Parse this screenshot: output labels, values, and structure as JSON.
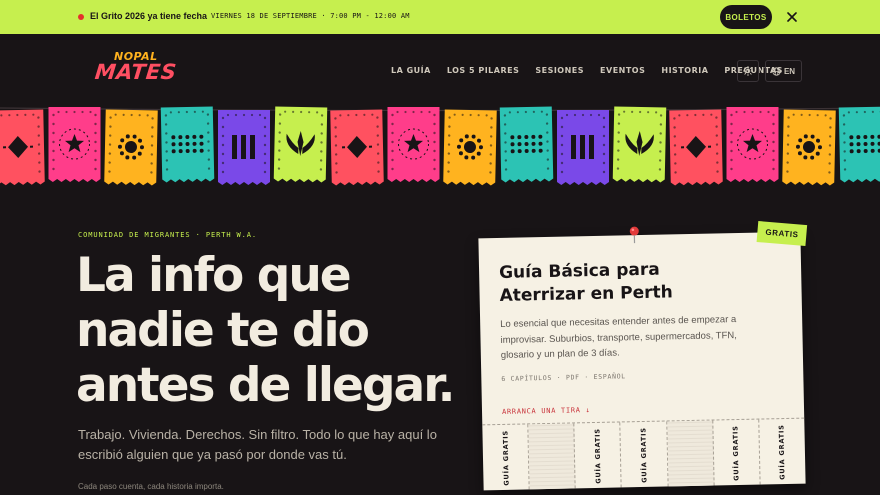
{
  "announcement": {
    "text": "El Grito 2026 ya tiene fecha",
    "date": "VIERNES 18 DE SEPTIEMBRE · 7:00 PM - 12:00 AM",
    "button": "BOLETOS",
    "close_icon": "close-icon"
  },
  "logo": {
    "line1": "NOPAL",
    "line2": "MATES"
  },
  "nav": {
    "items": [
      "LA GUÍA",
      "LOS 5 PILARES",
      "SESIONES",
      "EVENTOS",
      "HISTORIA",
      "PREGUNTAS"
    ],
    "theme_icon": "sun-icon",
    "lang_icon": "globe-icon",
    "lang_label": "EN"
  },
  "banner": {
    "flags": [
      {
        "color": "#ff5160",
        "icon": "diamond-icon"
      },
      {
        "color": "#ff3d8a",
        "icon": "star-icon"
      },
      {
        "color": "#ffb31f",
        "icon": "sun-icon"
      },
      {
        "color": "#2cc3b4",
        "icon": "dots-icon"
      },
      {
        "color": "#7a49e8",
        "icon": "bars-icon"
      },
      {
        "color": "#c6ef4e",
        "icon": "agave-icon"
      },
      {
        "color": "#ff5160",
        "icon": "diamond-icon"
      },
      {
        "color": "#ff3d8a",
        "icon": "star-icon"
      },
      {
        "color": "#ffb31f",
        "icon": "sun-icon"
      },
      {
        "color": "#2cc3b4",
        "icon": "dots-icon"
      },
      {
        "color": "#7a49e8",
        "icon": "bars-icon"
      },
      {
        "color": "#c6ef4e",
        "icon": "agave-icon"
      },
      {
        "color": "#ff5160",
        "icon": "diamond-icon"
      },
      {
        "color": "#ff3d8a",
        "icon": "star-icon"
      },
      {
        "color": "#ffb31f",
        "icon": "sun-icon"
      },
      {
        "color": "#2cc3b4",
        "icon": "dots-icon"
      }
    ]
  },
  "hero": {
    "eyebrow": "COMUNIDAD DE MIGRANTES · PERTH W.A.",
    "headline": [
      "La info que",
      "nadie te dio",
      "antes de llegar."
    ],
    "subtitle": "Trabajo. Vivienda. Derechos. Sin filtro. Todo lo que hay aquí lo escribió alguien que ya pasó por donde vas tú.",
    "tagline": "Cada paso cuenta, cada historia importa."
  },
  "guide_card": {
    "badge": "GRATIS",
    "title": "Guía Básica para Aterrizar en Perth",
    "description": "Lo esencial que necesitas entender antes de empezar a improvisar. Suburbios, transporte, supermercados, TFN, glosario y un plan de 3 días.",
    "meta": "6 CAPÍTULOS · PDF · ESPAÑOL",
    "cta": "ARRANCA UNA TIRA ↓",
    "strips": [
      {
        "label": "GUÍA GRATIS",
        "torn": false
      },
      {
        "label": "",
        "torn": true
      },
      {
        "label": "GUÍA GRATIS",
        "torn": false
      },
      {
        "label": "GUÍA GRATIS",
        "torn": false
      },
      {
        "label": "",
        "torn": true
      },
      {
        "label": "GUÍA GRATIS",
        "torn": false
      },
      {
        "label": "GUÍA GRATIS",
        "torn": false
      }
    ]
  },
  "colors": {
    "background": "#181416",
    "accent_lime": "#c6ef4e",
    "accent_red": "#c8323a",
    "card": "#f6f1e4"
  }
}
